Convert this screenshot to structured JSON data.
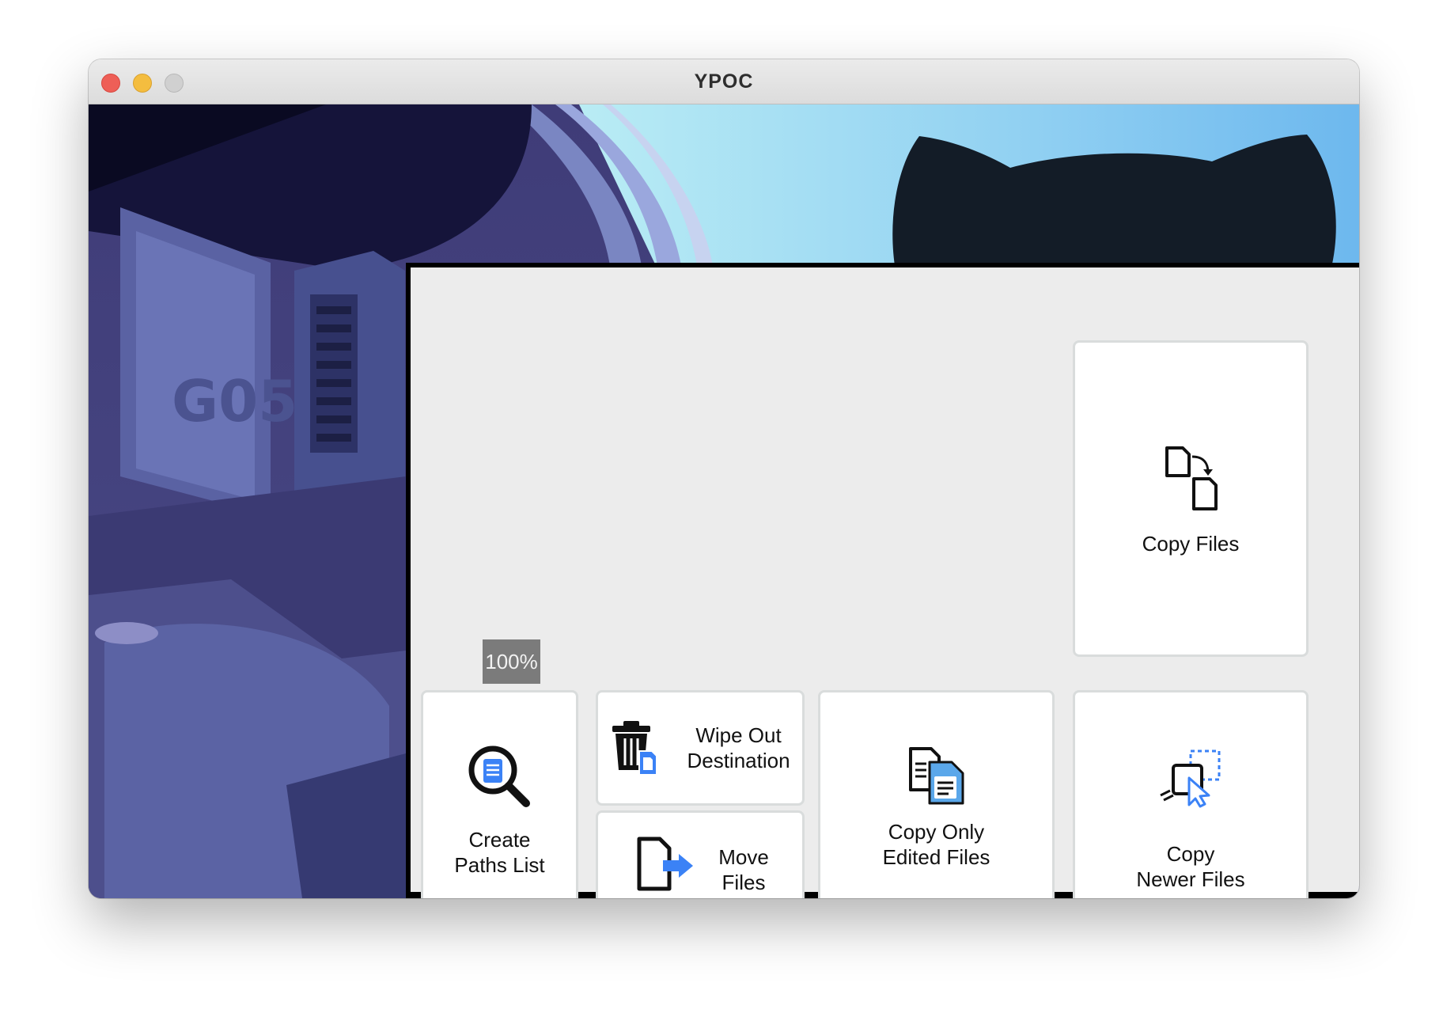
{
  "window": {
    "title": "YPOC"
  },
  "progress": {
    "text": "100%",
    "percent": 100
  },
  "buttons": {
    "copy_files": {
      "label": "Copy Files"
    },
    "create_paths_list": {
      "line1": "Create",
      "line2": "Paths List"
    },
    "wipe_out": {
      "line1": "Wipe Out",
      "line2": "Destination"
    },
    "move_files": {
      "line1": "Move",
      "line2": "Files"
    },
    "copy_only_edited": {
      "line1": "Copy Only",
      "line2": "Edited Files"
    },
    "copy_newer": {
      "line1": "Copy",
      "line2": "Newer Files"
    }
  },
  "background": {
    "emblem_text": "G05"
  },
  "colors": {
    "accent_blue": "#3b82f6",
    "tile_border": "#d9dcdc",
    "panel_bg": "#ececec"
  }
}
